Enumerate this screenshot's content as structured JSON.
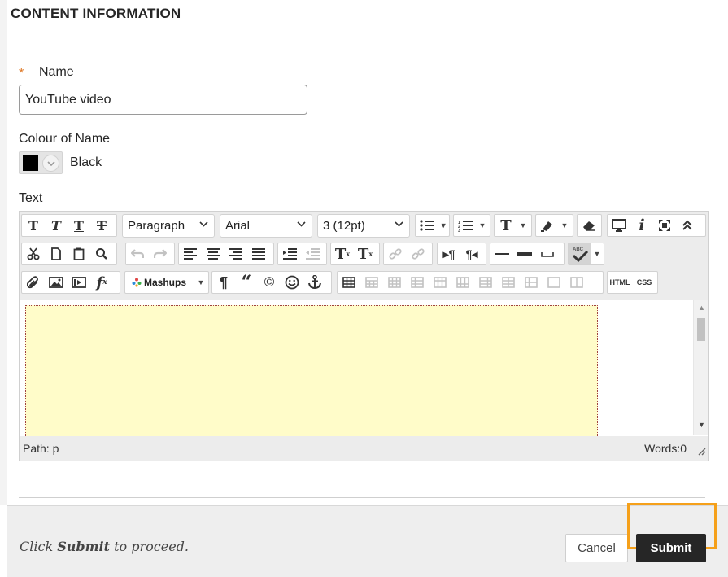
{
  "section": {
    "title": "CONTENT INFORMATION"
  },
  "name_field": {
    "label": "Name",
    "required_mark": "*",
    "value": "YouTube video"
  },
  "colour_field": {
    "label": "Colour of Name",
    "value_name": "Black",
    "swatch_color": "#000000"
  },
  "text_field": {
    "label": "Text"
  },
  "editor": {
    "format_select": "Paragraph",
    "font_select": "Arial",
    "size_select": "3 (12pt)",
    "mashups_label": "Mashups",
    "html_label": "HTML",
    "css_label": "CSS",
    "path_label": "Path: p",
    "words_label": "Words:0",
    "content_bg": "#fffcc9"
  },
  "footer": {
    "proceed_prefix": "Click ",
    "proceed_bold": "Submit",
    "proceed_suffix": " to proceed.",
    "cancel_label": "Cancel",
    "submit_label": "Submit",
    "highlight_color": "#f5a01a"
  }
}
